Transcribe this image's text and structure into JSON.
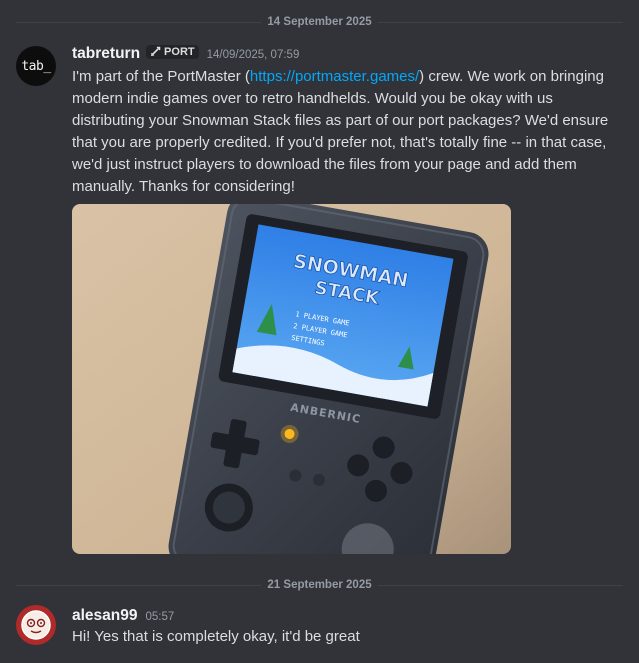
{
  "dividers": {
    "first": "14 September 2025",
    "second": "21 September 2025"
  },
  "messages": [
    {
      "author": "tabreturn",
      "avatar_text": "tab_",
      "tag": "PORT",
      "timestamp": "14/09/2025, 07:59",
      "text_before_link": "I'm part of the PortMaster (",
      "link_text": "https://portmaster.games/",
      "text_after_link": ") crew. We work on bringing modern indie games over to retro handhelds. Would you be okay with us distributing your Snowman Stack files as part of our port packages? We'd ensure that you are properly credited. If you'd prefer not, that's totally fine -- in that case, we'd just instruct players to download the files from your page and add them manually. Thanks for considering!",
      "image": {
        "screen_title_1": "SNOWMAN",
        "screen_title_2": "STACK",
        "menu_1": "1 PLAYER GAME",
        "menu_2": "2 PLAYER GAME",
        "menu_3": "SETTINGS",
        "device_brand": "ANBERNIC"
      }
    },
    {
      "author": "alesan99",
      "timestamp": "05:57",
      "text": "Hi! Yes that is completely okay, it'd be great"
    }
  ],
  "colors": {
    "background": "#313338",
    "link": "#00a8fc",
    "username": "#f2f3f5",
    "text": "#dbdee1",
    "muted": "#949ba4"
  }
}
